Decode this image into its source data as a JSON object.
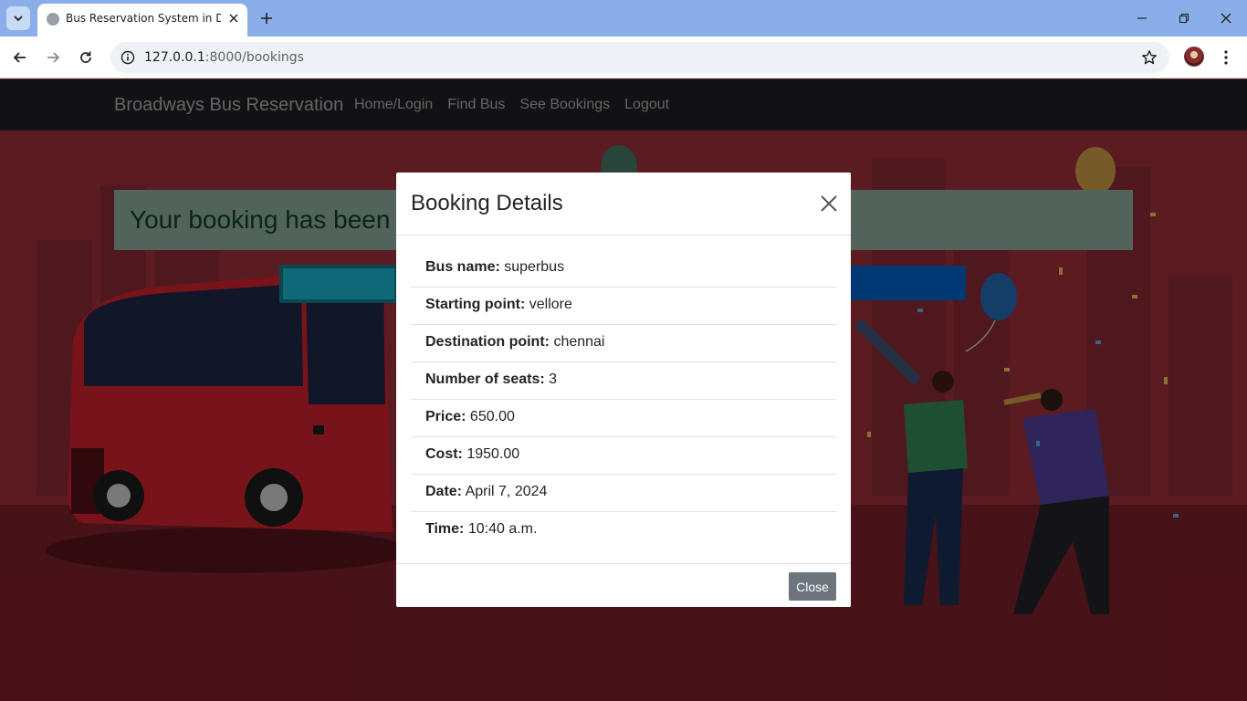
{
  "browser": {
    "tab_title": "Bus Reservation System in Djan",
    "url_host": "127.0.0.1",
    "url_rest": ":8000/bookings",
    "colors": {
      "tabbar": "#8aaee9",
      "omnibox": "#eef1f6"
    }
  },
  "site": {
    "brand": "Broadways Bus Reservation",
    "nav": {
      "home": "Home/Login",
      "find_bus": "Find Bus",
      "see_bookings": "See Bookings",
      "logout": "Logout"
    },
    "alert_text": "Your booking has been",
    "colors": {
      "navbar": "#1c1d1f",
      "page_bg": "#8a2a33"
    }
  },
  "modal": {
    "title": "Booking Details",
    "close_label": "Close",
    "details": [
      {
        "label": "Bus name:",
        "value": "superbus"
      },
      {
        "label": "Starting point:",
        "value": "vellore"
      },
      {
        "label": "Destination point:",
        "value": "chennai"
      },
      {
        "label": "Number of seats:",
        "value": "3"
      },
      {
        "label": "Price:",
        "value": "650.00"
      },
      {
        "label": "Cost:",
        "value": "1950.00"
      },
      {
        "label": "Date:",
        "value": "April 7, 2024"
      },
      {
        "label": "Time:",
        "value": "10:40 a.m."
      }
    ]
  }
}
